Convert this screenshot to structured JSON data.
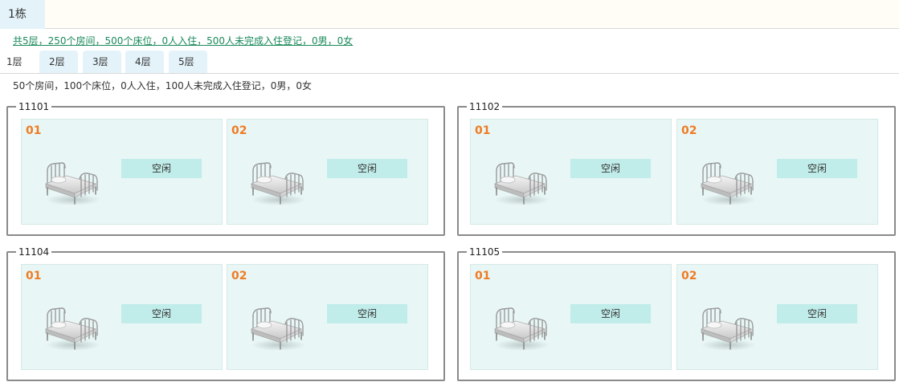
{
  "building": {
    "label": "1栋"
  },
  "summary": "共5层，250个房间，500个床位，0人入住，500人未完成入住登记，0男，0女",
  "floors": [
    {
      "label": "1层"
    },
    {
      "label": "2层"
    },
    {
      "label": "3层"
    },
    {
      "label": "4层"
    },
    {
      "label": "5层"
    }
  ],
  "active_floor": "1层",
  "floor_stats": "50个房间，100个床位，0人入住，100人未完成入住登记，0男，0女",
  "rooms": [
    {
      "number": "11101",
      "beds": [
        {
          "num": "01",
          "status": "空闲"
        },
        {
          "num": "02",
          "status": "空闲"
        }
      ]
    },
    {
      "number": "11102",
      "beds": [
        {
          "num": "01",
          "status": "空闲"
        },
        {
          "num": "02",
          "status": "空闲"
        }
      ]
    },
    {
      "number": "11104",
      "beds": [
        {
          "num": "01",
          "status": "空闲"
        },
        {
          "num": "02",
          "status": "空闲"
        }
      ]
    },
    {
      "number": "11105",
      "beds": [
        {
          "num": "01",
          "status": "空闲"
        },
        {
          "num": "02",
          "status": "空闲"
        }
      ]
    }
  ],
  "icons": {
    "bed": "hospital-bed-icon"
  },
  "colors": {
    "bed_number": "#ef7b23",
    "status_bg": "#c0ece9",
    "card_bg": "#e8f7f6",
    "tab_bg": "#e4f3fa",
    "summary_link": "#1a8a5a"
  }
}
